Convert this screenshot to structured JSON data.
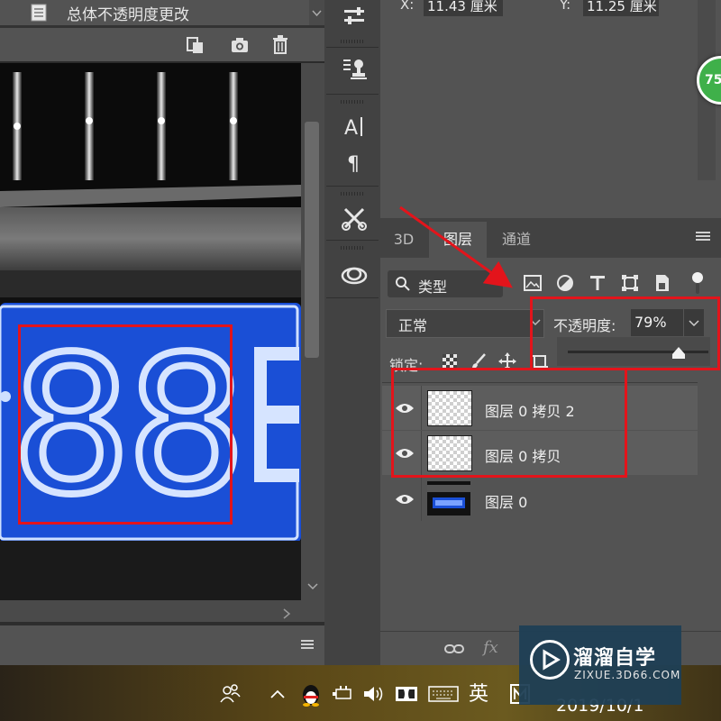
{
  "history": {
    "step_label": "总体不透明度更改"
  },
  "info_panel": {
    "x_label": "X:",
    "x_value": "11.43 厘米",
    "y_label": "Y:",
    "y_value": "11.25 厘米",
    "badge_text": "75"
  },
  "canvas": {
    "plate_digits": "88"
  },
  "layers_panel": {
    "tabs": [
      "3D",
      "图层",
      "通道"
    ],
    "active_tab": "图层",
    "filter_label": "类型",
    "blend_mode": "正常",
    "opacity_label": "不透明度:",
    "opacity_value": "79%",
    "opacity_fraction": 0.79,
    "lock_label": "锁定:",
    "layers": [
      {
        "name": "图层 0 拷贝 2",
        "thumbnail": "transparent",
        "visible": true
      },
      {
        "name": "图层 0 拷贝",
        "thumbnail": "transparent",
        "visible": true
      },
      {
        "name": "图层 0",
        "thumbnail": "image",
        "visible": true
      }
    ],
    "footer_fx": "fx"
  },
  "taskbar": {
    "ime": "英",
    "date": "2019/10/1"
  },
  "watermark": {
    "title": "溜溜自学",
    "url": "ZIXUE.3D66.COM"
  },
  "colors": {
    "annotation_red": "#e3141b",
    "plate_blue": "#1a4fd6",
    "badge_green": "#3fb04a"
  }
}
